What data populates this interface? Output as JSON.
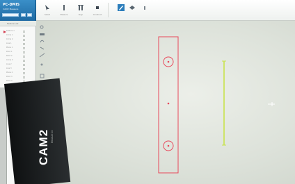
{
  "header": {
    "title": "PC-DMIS",
    "subtitle": "CAM2 Measure"
  },
  "ribbon": {
    "tools": [
      {
        "name": "select-tool",
        "label": "Select"
      },
      {
        "name": "measure-tool",
        "label": "Measure"
      },
      {
        "name": "align-tool",
        "label": "Align"
      },
      {
        "name": "construct-tool",
        "label": "Construct"
      },
      {
        "name": "pen-tool",
        "label": ""
      },
      {
        "name": "scan-tool",
        "label": ""
      },
      {
        "name": "more-tool",
        "label": ""
      }
    ]
  },
  "side_panel": {
    "header": "Feature List",
    "items": [
      {
        "label": "Feature 1"
      },
      {
        "label": "Circle 1"
      },
      {
        "label": "Circle 2"
      },
      {
        "label": "Line 1"
      },
      {
        "label": "Plane 1"
      },
      {
        "label": "Point 1"
      },
      {
        "label": "Point 2"
      },
      {
        "label": "Circle 3"
      },
      {
        "label": "Line 2"
      },
      {
        "label": "Line 3"
      },
      {
        "label": "Plane 2"
      },
      {
        "label": "Point 3"
      },
      {
        "label": "Point 4"
      },
      {
        "label": "Circle 4"
      },
      {
        "label": "Line 4"
      }
    ]
  },
  "branding": {
    "logo_text": "CAM2",
    "logo_sub": "Measure 10"
  },
  "colors": {
    "accent": "#2b7dbb",
    "feature_outline": "#e8475a",
    "probe_line": "#c8e34a"
  }
}
